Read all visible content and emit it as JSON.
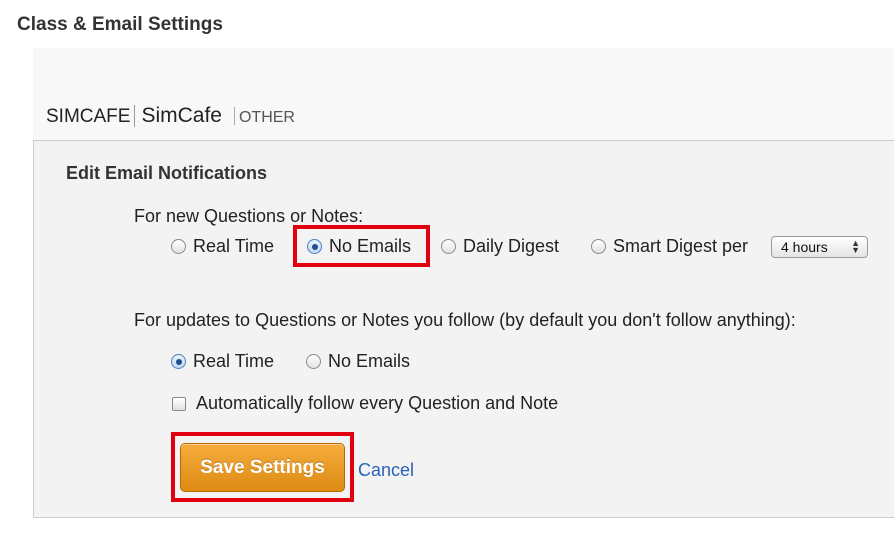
{
  "page": {
    "title": "Class & Email Settings"
  },
  "class_nav": {
    "code": "SIMCAFE",
    "name": "SimCafe",
    "other": "OTHER"
  },
  "panel": {
    "heading": "Edit Email Notifications",
    "new_posts": {
      "label": "For new Questions or Notes:",
      "options": [
        {
          "label": "Real Time",
          "checked": false
        },
        {
          "label": "No Emails",
          "checked": true
        },
        {
          "label": "Daily Digest",
          "checked": false
        },
        {
          "label": "Smart Digest per",
          "checked": false
        }
      ],
      "digest_interval": {
        "selected": "4 hours"
      }
    },
    "followed": {
      "label": "For updates to Questions or Notes you follow (by default you don't follow anything):",
      "options": [
        {
          "label": "Real Time",
          "checked": true
        },
        {
          "label": "No Emails",
          "checked": false
        }
      ]
    },
    "auto_follow": {
      "label": "Automatically follow every Question and Note",
      "checked": false
    },
    "save_label": "Save Settings",
    "cancel_label": "Cancel"
  },
  "colors": {
    "highlight": "#e0000f",
    "save_button": "#ec9a22",
    "link": "#2a62b8",
    "panel_bg": "#f3f3f3"
  }
}
